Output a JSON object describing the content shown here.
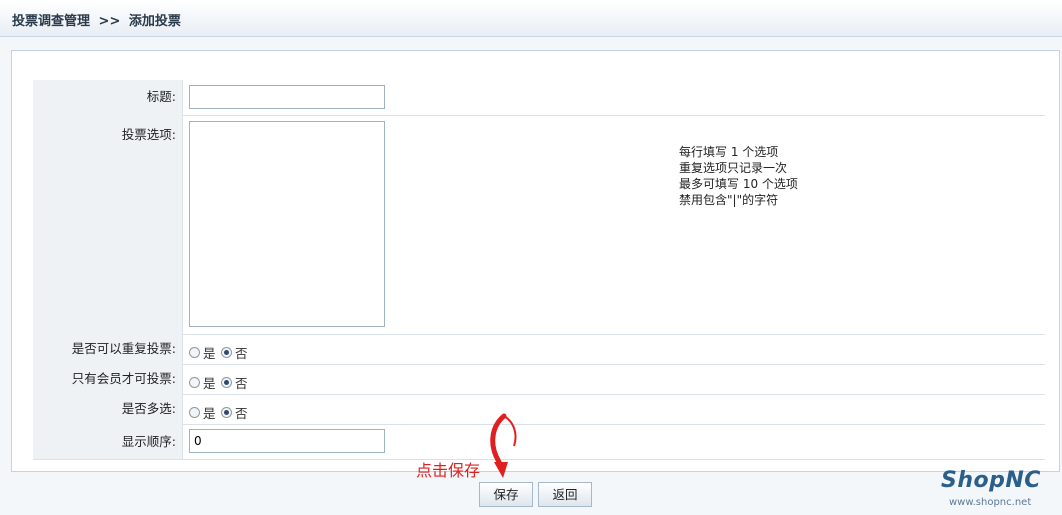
{
  "breadcrumb": {
    "section": "投票调查管理",
    "separator": ">>",
    "current": "添加投票"
  },
  "form": {
    "title_label": "标题:",
    "title_value": "",
    "options_label": "投票选项:",
    "options_value": "",
    "options_hint": [
      "每行填写 1 个选项",
      "重复选项只记录一次",
      "最多可填写 10 个选项",
      "禁用包含\"|\"的字符"
    ],
    "repeat_label": "是否可以重复投票:",
    "member_label": "只有会员才可投票:",
    "multi_label": "是否多选:",
    "yes": "是",
    "no": "否",
    "order_label": "显示顺序:",
    "order_value": "0"
  },
  "radios": {
    "repeat_selected": "否",
    "member_selected": "否",
    "multi_selected": "否"
  },
  "buttons": {
    "save": "保存",
    "back": "返回"
  },
  "annotation": {
    "text": "点击保存",
    "color": "#e02020"
  },
  "brand": {
    "name": "ShopNC",
    "url": "www.shopnc.net"
  }
}
